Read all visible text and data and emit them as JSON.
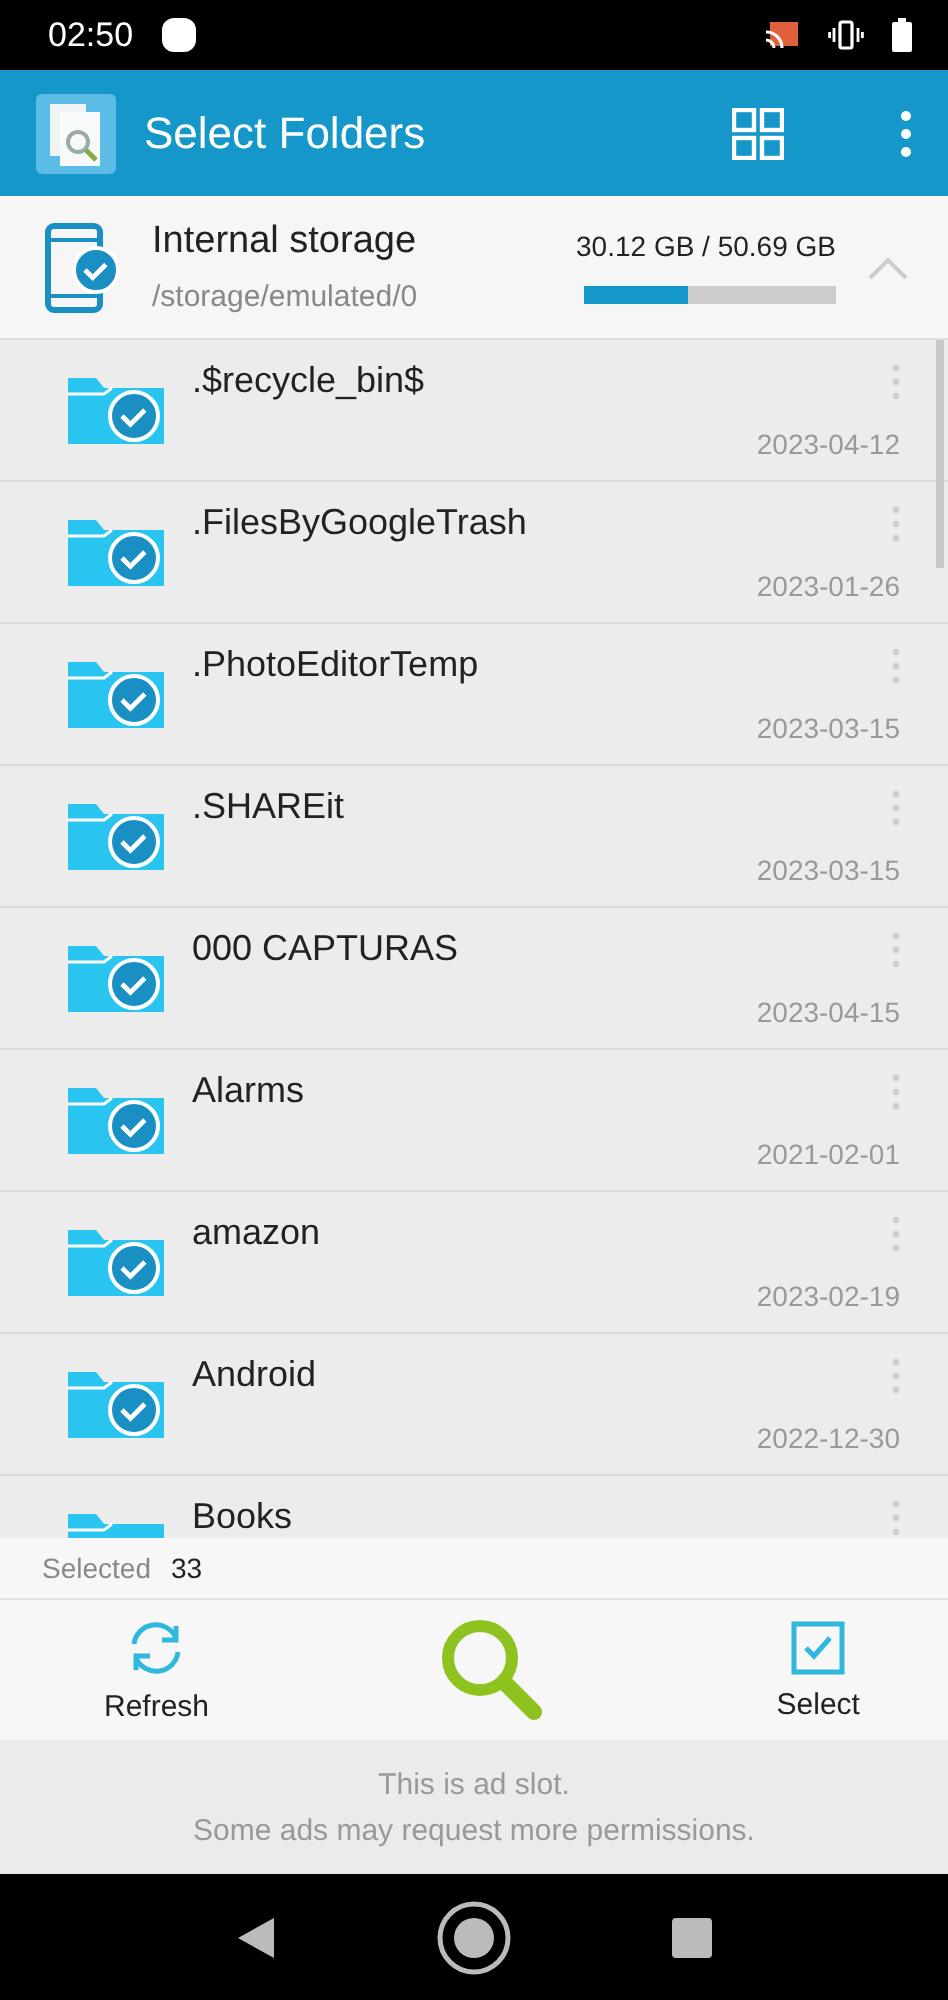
{
  "status_bar": {
    "time": "02:50"
  },
  "toolbar": {
    "title": "Select Folders"
  },
  "storage": {
    "name": "Internal storage",
    "path": "/storage/emulated/0",
    "usage": "30.12 GB / 50.69 GB",
    "level": 0.41,
    "checked": true,
    "expanded": true
  },
  "folders": [
    {
      "name": ".$recycle_bin$",
      "date": "2023-04-12",
      "checked": true
    },
    {
      "name": ".FilesByGoogleTrash",
      "date": "2023-01-26",
      "checked": true
    },
    {
      "name": ".PhotoEditorTemp",
      "date": "2023-03-15",
      "checked": true
    },
    {
      "name": ".SHAREit",
      "date": "2023-03-15",
      "checked": true
    },
    {
      "name": "000 CAPTURAS",
      "date": "2023-04-15",
      "checked": true
    },
    {
      "name": "Alarms",
      "date": "2021-02-01",
      "checked": true
    },
    {
      "name": "amazon",
      "date": "2023-02-19",
      "checked": true
    },
    {
      "name": "Android",
      "date": "2022-12-30",
      "checked": true
    },
    {
      "name": "Books"
    }
  ],
  "selection": {
    "label": "Selected",
    "count": "33"
  },
  "actions": [
    {
      "kind": "refresh",
      "label": "Refresh"
    },
    {
      "kind": "search"
    },
    {
      "kind": "select",
      "label": "Select"
    }
  ],
  "ad": {
    "lines": [
      "This is ad slot.",
      "Some ads may request more permissions."
    ]
  }
}
